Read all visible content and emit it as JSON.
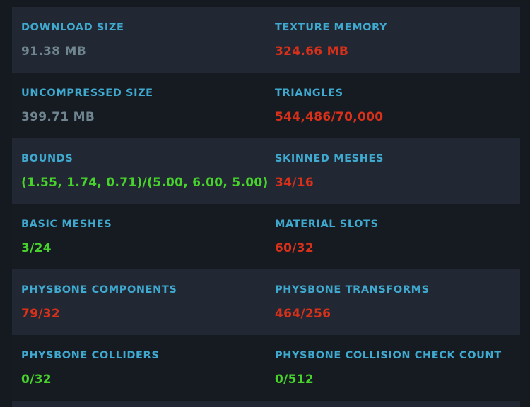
{
  "stats": {
    "row1": {
      "left": {
        "label": "DOWNLOAD SIZE",
        "value": "91.38 MB",
        "status_color": "#6f8590"
      },
      "right": {
        "label": "TEXTURE MEMORY",
        "value": "324.66 MB",
        "status_color": "#d9301a"
      }
    },
    "row2": {
      "left": {
        "label": "UNCOMPRESSED SIZE",
        "value": "399.71 MB",
        "status_color": "#6f8590"
      },
      "right": {
        "label": "TRIANGLES",
        "value": "544,486/70,000",
        "status_color": "#d9301a"
      }
    },
    "row3": {
      "left": {
        "label": "BOUNDS",
        "value": "(1.55, 1.74, 0.71)/(5.00, 6.00, 5.00)",
        "status_color": "#47d32b"
      },
      "right": {
        "label": "SKINNED MESHES",
        "value": "34/16",
        "status_color": "#d9301a"
      }
    },
    "row4": {
      "left": {
        "label": "BASIC MESHES",
        "value": "3/24",
        "status_color": "#47d32b"
      },
      "right": {
        "label": "MATERIAL SLOTS",
        "value": "60/32",
        "status_color": "#d9301a"
      }
    },
    "row5": {
      "left": {
        "label": "PHYSBONE COMPONENTS",
        "value": "79/32",
        "status_color": "#d9301a"
      },
      "right": {
        "label": "PHYSBONE TRANSFORMS",
        "value": "464/256",
        "status_color": "#d9301a"
      }
    },
    "row6": {
      "left": {
        "label": "PHYSBONE COLLIDERS",
        "value": "0/32",
        "status_color": "#47d32b"
      },
      "right": {
        "label": "PHYSBONE COLLISION CHECK COUNT",
        "value": "0/512",
        "status_color": "#47d32b"
      }
    }
  },
  "colors": {
    "label": "#3fa9cf",
    "neutral": "#6f8590",
    "over_limit": "#d9301a",
    "within_limit": "#47d32b",
    "row_shaded": "#222833",
    "background": "#151a21"
  }
}
